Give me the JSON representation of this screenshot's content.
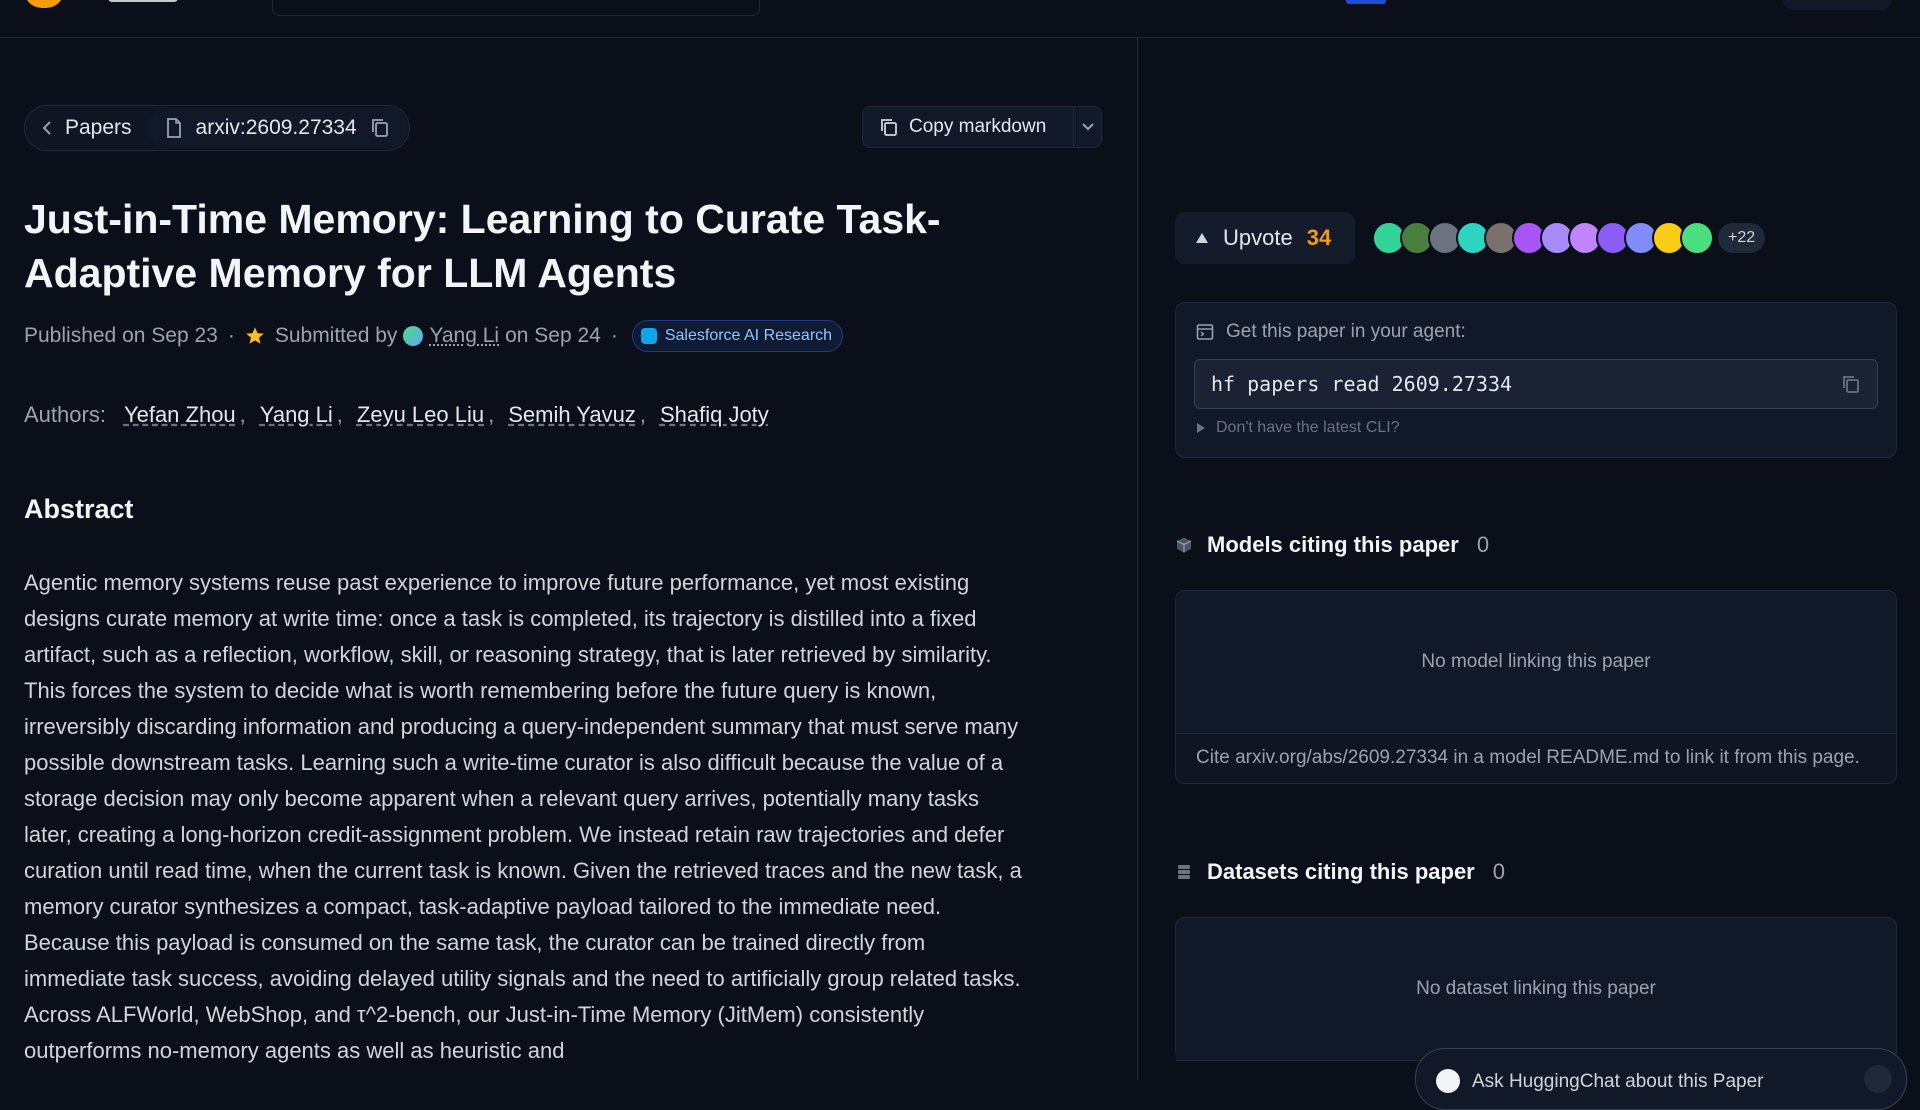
{
  "breadcrumb": {
    "back_label": "Papers",
    "paper_id": "arxiv:2609.27334"
  },
  "actions": {
    "copy_markdown": "Copy markdown"
  },
  "paper": {
    "title": "Just-in-Time Memory: Learning to Curate Task-Adaptive Memory for LLM Agents",
    "published": "Published on Sep 23",
    "submitted_prefix": "Submitted by",
    "submitter": "Yang Li",
    "submitted_date": "on Sep 24",
    "org": "Salesforce AI Research",
    "authors_label": "Authors:",
    "authors": [
      "Yefan Zhou",
      "Yang Li",
      "Zeyu Leo Liu",
      "Semih Yavuz",
      "Shafiq Joty"
    ],
    "abstract_heading": "Abstract",
    "abstract": "Agentic memory systems reuse past experience to improve future performance, yet most existing designs curate memory at write time: once a task is completed, its trajectory is distilled into a fixed artifact, such as a reflection, workflow, skill, or reasoning strategy, that is later retrieved by similarity. This forces the system to decide what is worth remembering before the future query is known, irreversibly discarding information and producing a query-independent summary that must serve many possible downstream tasks. Learning such a write-time curator is also difficult because the value of a storage decision may only become apparent when a relevant query arrives, potentially many tasks later, creating a long-horizon credit-assignment problem. We instead retain raw trajectories and defer curation until read time, when the current task is known. Given the retrieved traces and the new task, a memory curator synthesizes a compact, task-adaptive payload tailored to the immediate need. Because this payload is consumed on the same task, the curator can be trained directly from immediate task success, avoiding delayed utility signals and the need to artificially group related tasks. Across ALFWorld, WebShop, and τ^2-bench, our Just-in-Time Memory (JitMem) consistently outperforms no-memory agents as well as heuristic and"
  },
  "upvote": {
    "label": "Upvote",
    "count": "34",
    "more_voters": "+22"
  },
  "voter_colors": [
    "#34d399",
    "#4b7f3f",
    "#6b7280",
    "#2dd4bf",
    "#78716c",
    "#a855f7",
    "#a78bfa",
    "#c084fc",
    "#8b5cf6",
    "#818cf8",
    "#facc15",
    "#4ade80"
  ],
  "agent": {
    "heading": "Get this paper in your agent:",
    "command": "hf papers read 2609.27334",
    "hint": "Don't have the latest CLI?"
  },
  "models": {
    "heading": "Models citing this paper",
    "count": "0",
    "empty": "No model linking this paper",
    "cite": "Cite arxiv.org/abs/2609.27334 in a model README.md to link it from this page."
  },
  "datasets": {
    "heading": "Datasets citing this paper",
    "count": "0",
    "empty": "No dataset linking this paper"
  },
  "chat": {
    "placeholder": "Ask HuggingChat about this Paper"
  },
  "colors": {
    "accent": "#f59e0b",
    "background": "#0b0f19",
    "org_badge": "#93c5fd"
  }
}
